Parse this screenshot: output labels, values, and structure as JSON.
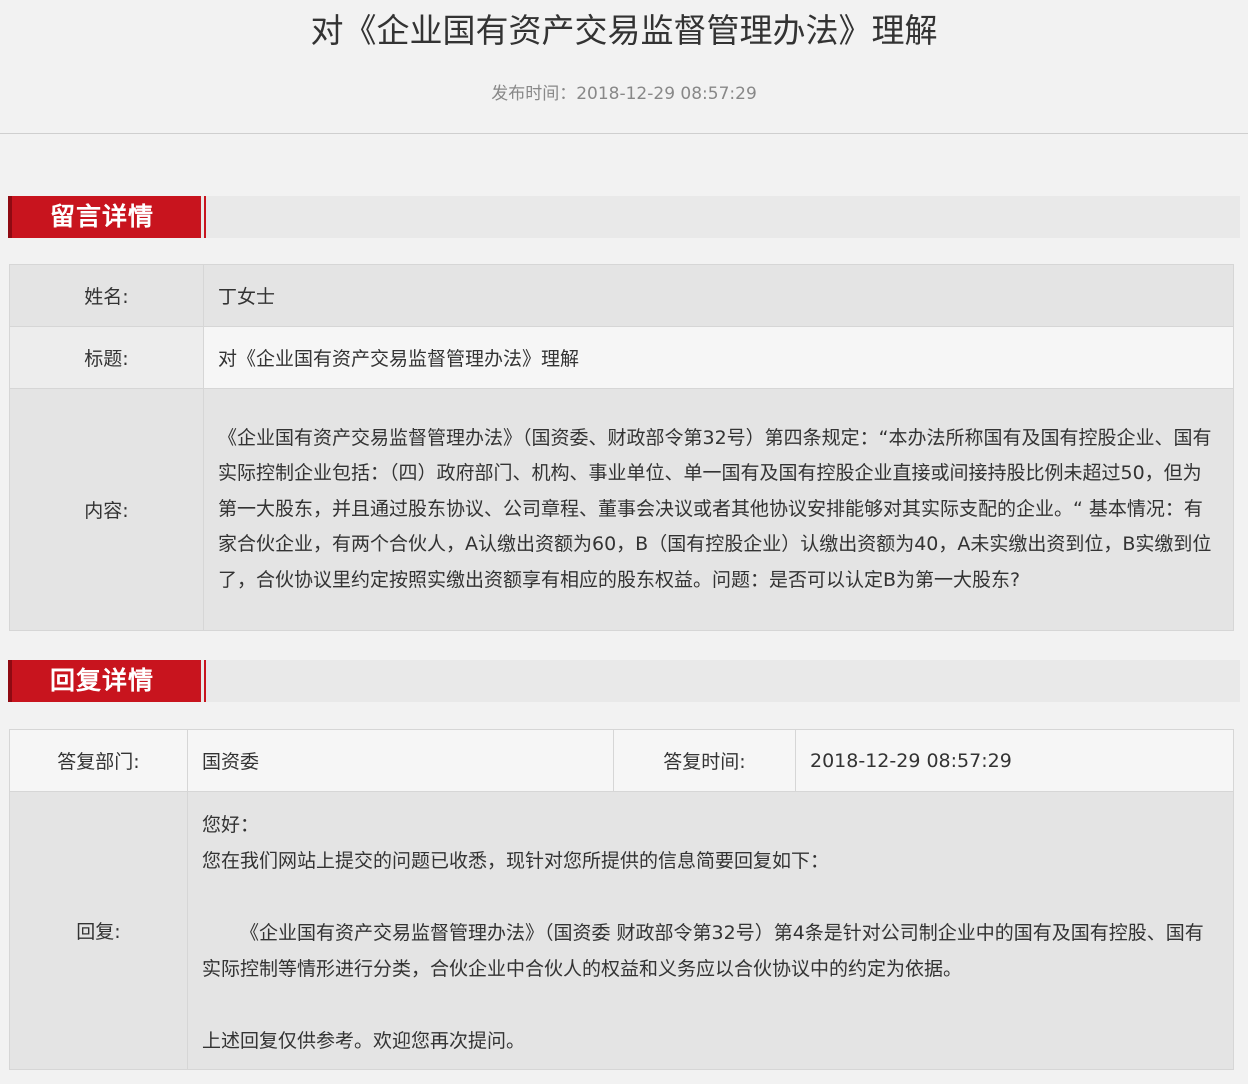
{
  "page": {
    "title": "对《企业国有资产交易监督管理办法》理解",
    "publish_label": "发布时间：",
    "publish_time": "2018-12-29 08:57:29"
  },
  "message_section": {
    "heading": "留言详情",
    "name_label": "姓名:",
    "name_value": "丁女士",
    "title_label": "标题:",
    "title_value": "对《企业国有资产交易监督管理办法》理解",
    "content_label": "内容:",
    "content_value": "《企业国有资产交易监督管理办法》（国资委、财政部令第32号）第四条规定：“本办法所称国有及国有控股企业、国有实际控制企业包括：（四）政府部门、机构、事业单位、单一国有及国有控股企业直接或间接持股比例未超过50，但为第一大股东，并且通过股东协议、公司章程、董事会决议或者其他协议安排能够对其实际支配的企业。“ 基本情况：有家合伙企业，有两个合伙人，A认缴出资额为60，B（国有控股企业）认缴出资额为40，A未实缴出资到位，B实缴到位了，合伙协议里约定按照实缴出资额享有相应的股东权益。问题：是否可以认定B为第一大股东?"
  },
  "reply_section": {
    "heading": "回复详情",
    "dept_label": "答复部门:",
    "dept_value": "国资委",
    "time_label": "答复时间:",
    "time_value": "2018-12-29 08:57:29",
    "reply_label": "回复:",
    "greeting": "您好：",
    "intro": "您在我们网站上提交的问题已收悉，现针对您所提供的信息简要回复如下：",
    "body": "《企业国有资产交易监督管理办法》（国资委 财政部令第32号）第4条是针对公司制企业中的国有及国有控股、国有实际控制等情形进行分类，合伙企业中合伙人的权益和义务应以合伙协议中的约定为依据。",
    "closing": "上述回复仅供参考。欢迎您再次提问。"
  },
  "colors": {
    "accent_red": "#c8141e",
    "background": "#f2f2f2"
  }
}
